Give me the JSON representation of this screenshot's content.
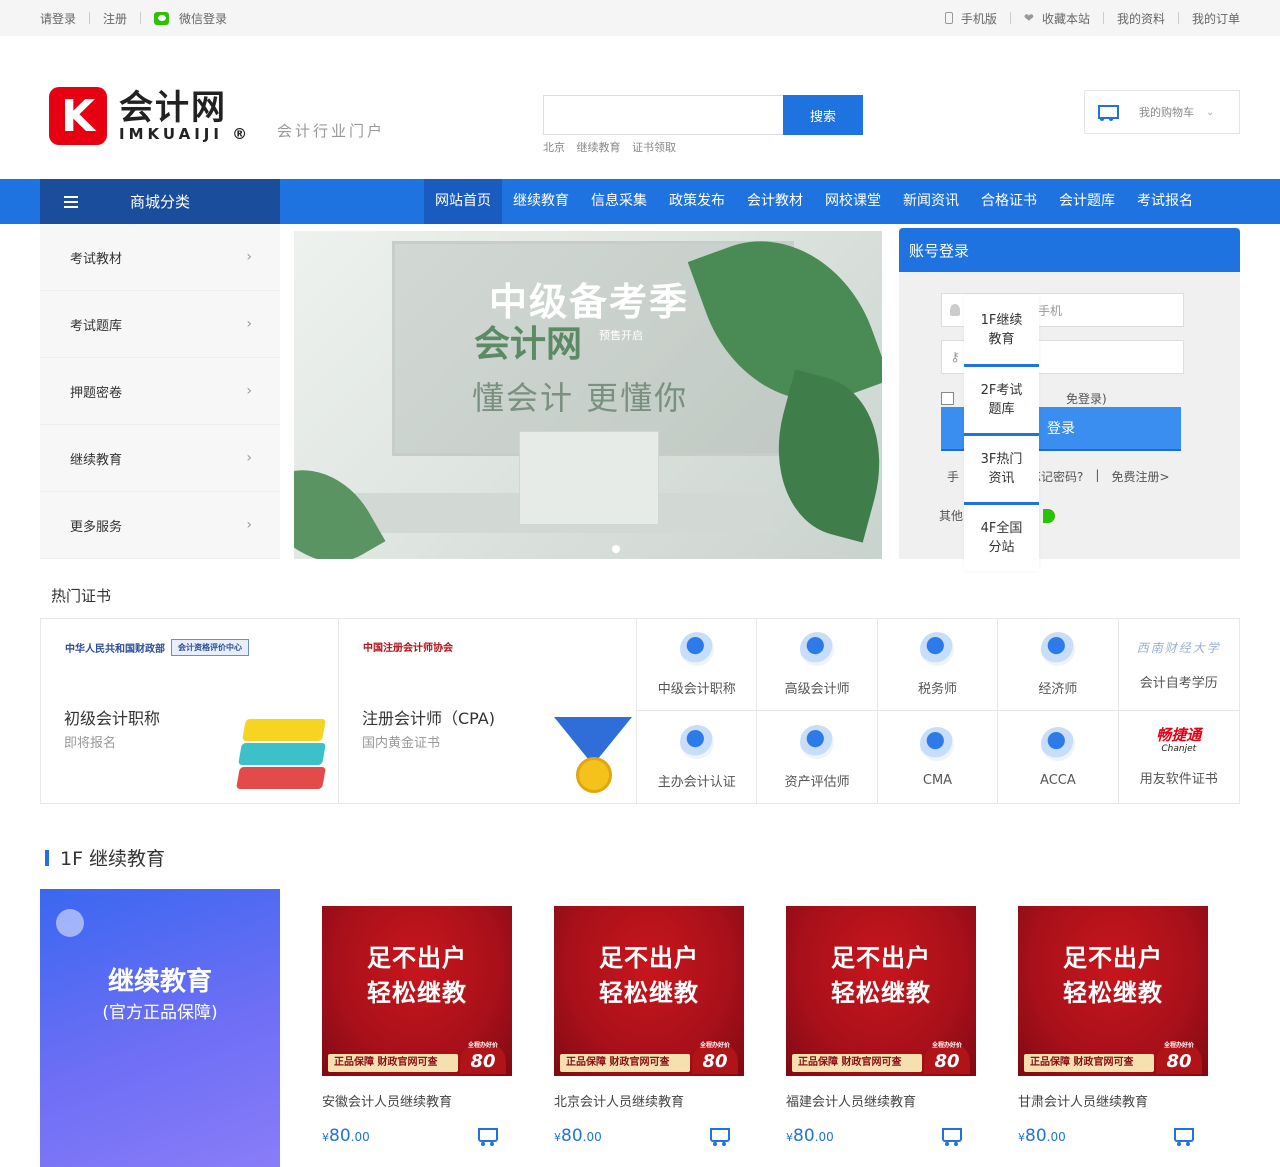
{
  "topbar": {
    "login": "请登录",
    "register": "注册",
    "wechat_login": "微信登录",
    "mobile": "手机版",
    "favorite": "收藏本站",
    "profile": "我的资料",
    "orders": "我的订单"
  },
  "header": {
    "logo_letter": "K",
    "logo_cn": "会计网",
    "logo_en": "IMKUAIJI ®",
    "slogan": "会计行业门户",
    "search_placeholder": "",
    "search_button": "搜索",
    "hot_keywords": [
      "北京",
      "继续教育",
      "证书领取"
    ],
    "cart": "我的购物车"
  },
  "nav": {
    "category": "商城分类",
    "items": [
      "网站首页",
      "继续教育",
      "信息采集",
      "政策发布",
      "会计教材",
      "网校课堂",
      "新闻资讯",
      "合格证书",
      "会计题库",
      "考试报名"
    ]
  },
  "sidemenu": [
    "考试教材",
    "考试题库",
    "押题密卷",
    "继续教育",
    "更多服务"
  ],
  "banner": {
    "title": "中级备考季",
    "brand": "会计网",
    "sub": "预售开启",
    "slogan": "懂会计 更懂你"
  },
  "login": {
    "title": "账号登录",
    "account_hint": "手机",
    "remember": "免登录)",
    "submit": "登录",
    "phone_login": "手",
    "forgot": "忘记密码?",
    "sep": "|",
    "register": "免费注册>",
    "other": "其他"
  },
  "floatnav": [
    "1F继续教育",
    "2F考试题库",
    "3F热门资讯",
    "4F全国分站"
  ],
  "hot": {
    "title": "热门证书",
    "big": [
      {
        "org": "中华人民共和国财政部",
        "org_badge": "会计资格评价中心",
        "name": "初级会计职称",
        "desc": "即将报名"
      },
      {
        "org": "中国注册会计师协会",
        "org_badge": "",
        "name": "注册会计师（CPA)",
        "desc": "国内黄金证书"
      }
    ],
    "grid": [
      "中级会计职称",
      "高级会计师",
      "税务师",
      "经济师",
      "会计自考学历",
      "主办会计认证",
      "资产评估师",
      "CMA",
      "ACCA",
      "用友软件证书"
    ],
    "xn_logo": "西南财经大学",
    "cj_logo": "畅捷通",
    "cj_sub": "Chanjet"
  },
  "floor1": {
    "title": "1F 继续教育",
    "banner_title": "继续教育",
    "banner_sub": "(官方正品保障)",
    "products": [
      {
        "line1": "足不出户",
        "line2": "轻松继教",
        "stripe": "正品保障  财政官网可查",
        "badge_top": "全程办好价",
        "badge": "80",
        "name": "安徽会计人员继续教育",
        "currency": "¥",
        "int": "80",
        "dec": ".00"
      },
      {
        "line1": "足不出户",
        "line2": "轻松继教",
        "stripe": "正品保障  财政官网可查",
        "badge_top": "全程办好价",
        "badge": "80",
        "name": "北京会计人员继续教育",
        "currency": "¥",
        "int": "80",
        "dec": ".00"
      },
      {
        "line1": "足不出户",
        "line2": "轻松继教",
        "stripe": "正品保障  财政官网可查",
        "badge_top": "全程办好价",
        "badge": "80",
        "name": "福建会计人员继续教育",
        "currency": "¥",
        "int": "80",
        "dec": ".00"
      },
      {
        "line1": "足不出户",
        "line2": "轻松继教",
        "stripe": "正品保障  财政官网可查",
        "badge_top": "全程办好价",
        "badge": "80",
        "name": "甘肃会计人员继续教育",
        "currency": "¥",
        "int": "80",
        "dec": ".00"
      }
    ]
  },
  "colors": {
    "primary": "#1e73e0",
    "nav_dark": "#1a4e9c",
    "brand_red": "#e60012"
  }
}
